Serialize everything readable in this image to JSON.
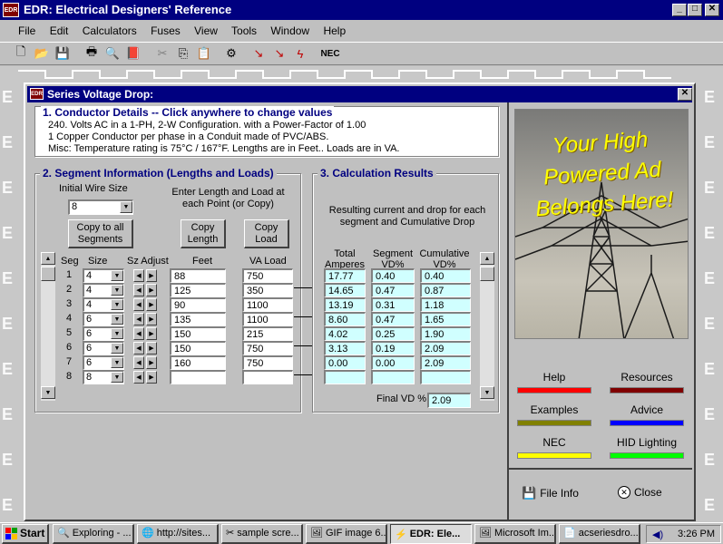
{
  "app": {
    "title": "EDR: Electrical Designers' Reference",
    "icon_text": "EDR"
  },
  "menu": [
    "File",
    "Edit",
    "Calculators",
    "Fuses",
    "View",
    "Tools",
    "Window",
    "Help"
  ],
  "toolbar": {
    "nec_label": "NEC"
  },
  "dialog": {
    "title": "Series Voltage Drop:"
  },
  "conductor": {
    "title": "1. Conductor Details -- Click anywhere to change values",
    "line1": "240. Volts AC in a 1-PH, 2-W Configuration. with a Power-Factor of 1.00",
    "line2": "1 Copper Conductor per phase in a Conduit made of PVC/ABS.",
    "line3": "Misc: Temperature rating is 75°C / 167°F.   Lengths are in Feet..   Loads are in VA."
  },
  "segment": {
    "title": "2. Segment Information (Lengths and Loads)",
    "initial_wire_label": "Initial Wire Size",
    "initial_wire_value": "8",
    "copy_all_line1": "Copy to all",
    "copy_all_line2": "Segments",
    "enter_line1": "Enter Length and Load at",
    "enter_line2": "each Point (or Copy)",
    "copy_length_line1": "Copy",
    "copy_length_line2": "Length",
    "copy_load_line1": "Copy",
    "copy_load_line2": "Load",
    "col_seg": "Seg",
    "col_size": "Size",
    "col_sz_adjust": "Sz Adjust",
    "col_feet": "Feet",
    "col_va": "VA Load",
    "rows": [
      {
        "seg": "1",
        "size": "4",
        "feet": "88",
        "va": "750"
      },
      {
        "seg": "2",
        "size": "4",
        "feet": "125",
        "va": "350"
      },
      {
        "seg": "3",
        "size": "4",
        "feet": "90",
        "va": "1100"
      },
      {
        "seg": "4",
        "size": "6",
        "feet": "135",
        "va": "1100"
      },
      {
        "seg": "5",
        "size": "6",
        "feet": "150",
        "va": "215"
      },
      {
        "seg": "6",
        "size": "6",
        "feet": "150",
        "va": "750"
      },
      {
        "seg": "7",
        "size": "6",
        "feet": "160",
        "va": "750"
      },
      {
        "seg": "8",
        "size": "8",
        "feet": "",
        "va": ""
      }
    ]
  },
  "results": {
    "title": "3. Calculation Results",
    "desc_line1": "Resulting current and drop for each",
    "desc_line2": "segment and Cumulative Drop",
    "col_total_line1": "Total",
    "col_total_line2": "Amperes",
    "col_seg_line1": "Segment",
    "col_seg_line2": "VD%",
    "col_cum_line1": "Cumulative",
    "col_cum_line2": "VD%",
    "rows": [
      {
        "amps": "17.77",
        "seg_vd": "0.40",
        "cum_vd": "0.40"
      },
      {
        "amps": "14.65",
        "seg_vd": "0.47",
        "cum_vd": "0.87"
      },
      {
        "amps": "13.19",
        "seg_vd": "0.31",
        "cum_vd": "1.18"
      },
      {
        "amps": "8.60",
        "seg_vd": "0.47",
        "cum_vd": "1.65"
      },
      {
        "amps": "4.02",
        "seg_vd": "0.25",
        "cum_vd": "1.90"
      },
      {
        "amps": "3.13",
        "seg_vd": "0.19",
        "cum_vd": "2.09"
      },
      {
        "amps": "0.00",
        "seg_vd": "0.00",
        "cum_vd": "2.09"
      },
      {
        "amps": "",
        "seg_vd": "",
        "cum_vd": ""
      }
    ],
    "final_vd_label": "Final VD %",
    "final_vd_value": "2.09"
  },
  "ad": {
    "line1": "Your High",
    "line2": "Powered Ad",
    "line3": "Belongs Here!"
  },
  "links": [
    {
      "label": "Help",
      "color": "#ff0000"
    },
    {
      "label": "Resources",
      "color": "#800000"
    },
    {
      "label": "Examples",
      "color": "#808000"
    },
    {
      "label": "Advice",
      "color": "#0000ff"
    },
    {
      "label": "NEC",
      "color": "#ffff00"
    },
    {
      "label": "HID Lighting",
      "color": "#00ff00"
    }
  ],
  "bottom": {
    "file_info": "File Info",
    "close": "Close"
  },
  "taskbar": {
    "start": "Start",
    "tasks": [
      "Exploring - ...",
      "http://sites...",
      "sample scre...",
      "GIF image 6...",
      "EDR: Ele...",
      "Microsoft Im...",
      "acseriesdro..."
    ],
    "clock": "3:26 PM"
  }
}
